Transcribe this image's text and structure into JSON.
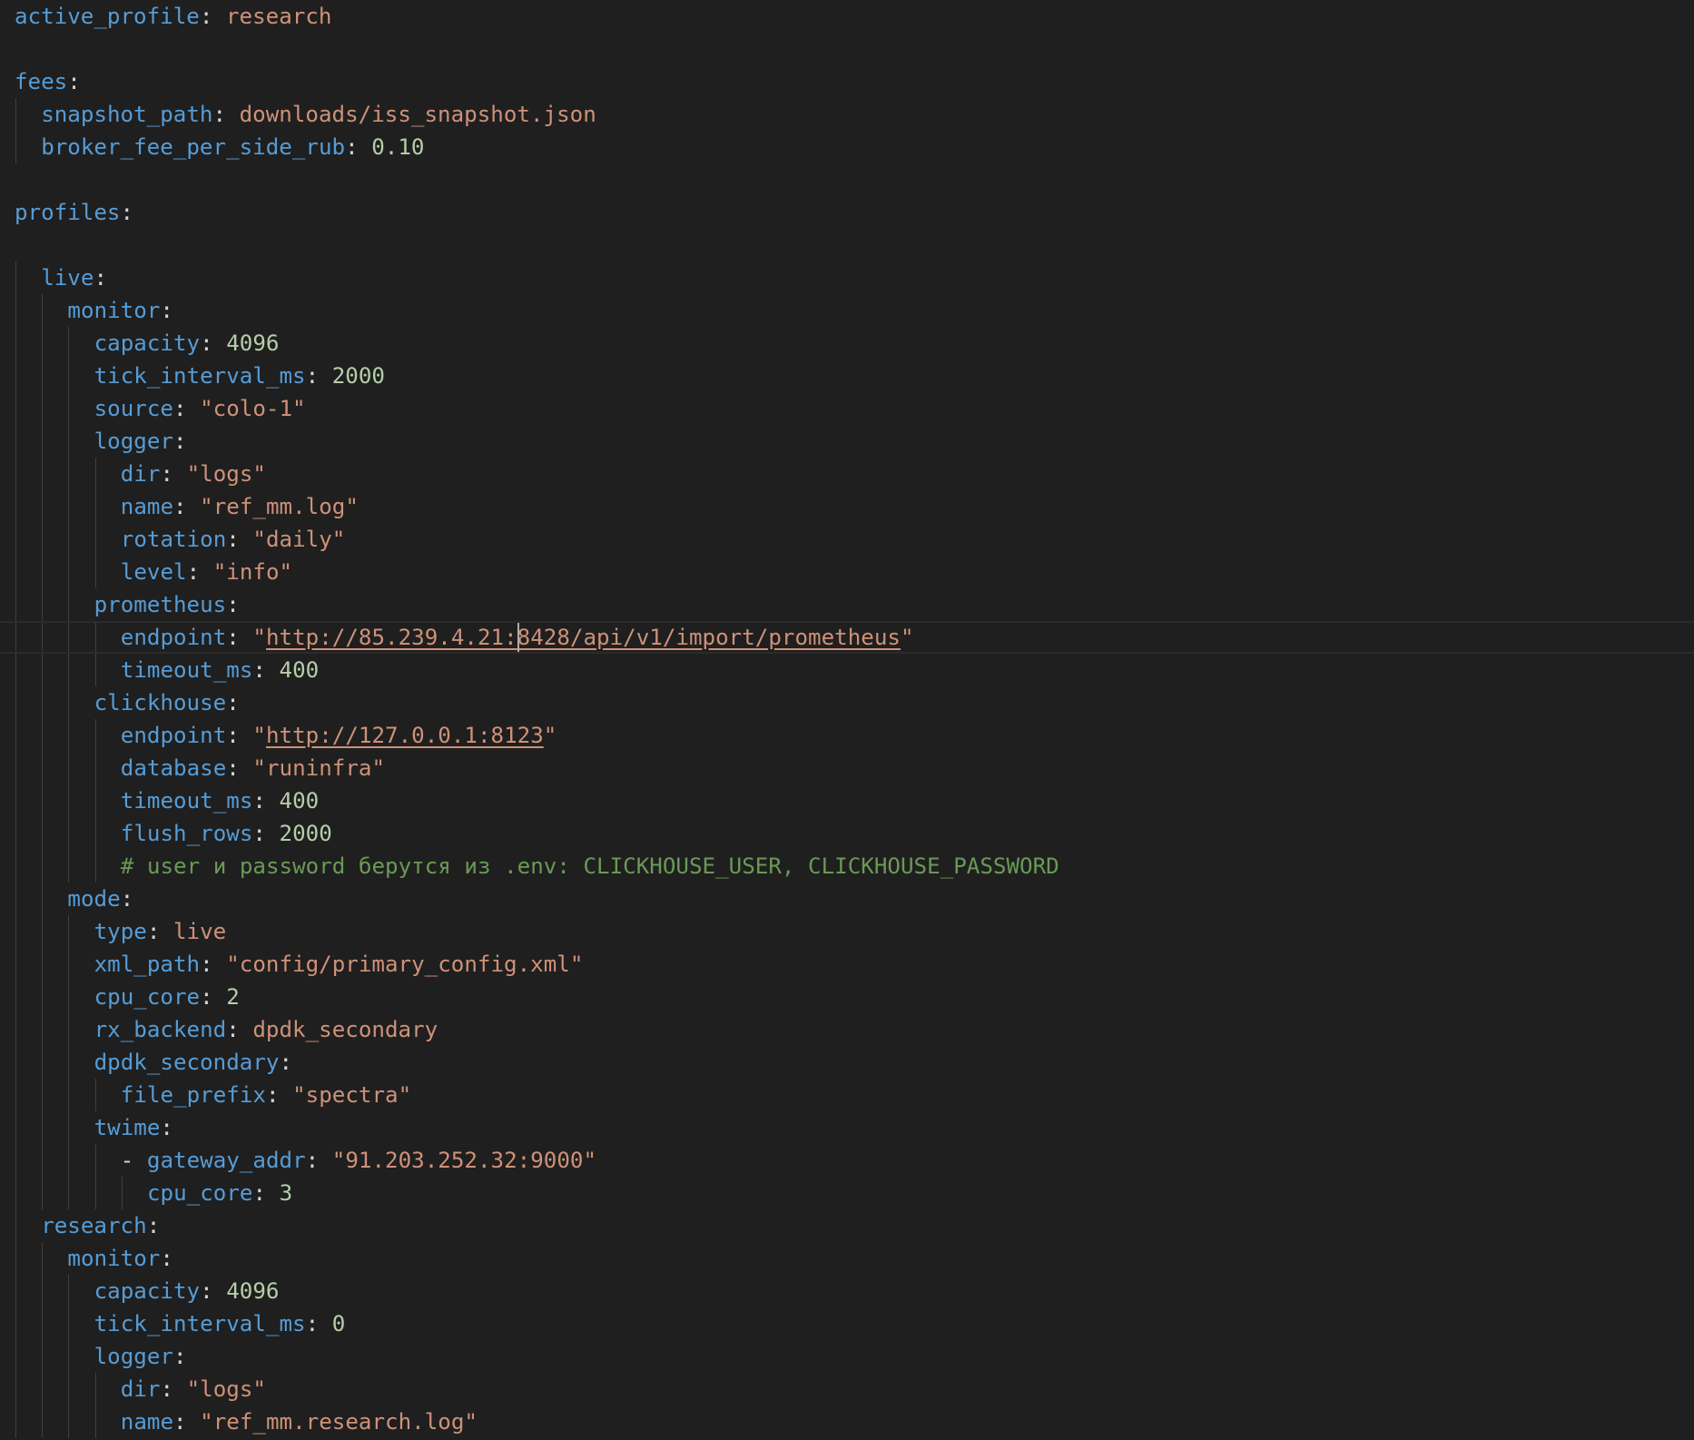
{
  "editor": {
    "language": "yaml",
    "colors": {
      "background": "#1f1f1f",
      "key": "#569cd6",
      "string": "#ce9178",
      "number": "#b5cea8",
      "comment": "#6a9955",
      "punctuation": "#d4d4d4"
    },
    "lines": [
      [
        {
          "t": "k",
          "v": "active_profile"
        },
        {
          "t": "p",
          "v": ": "
        },
        {
          "t": "s",
          "v": "research"
        }
      ],
      [],
      [
        {
          "t": "k",
          "v": "fees"
        },
        {
          "t": "p",
          "v": ":"
        }
      ],
      [
        {
          "t": "k",
          "v": "snapshot_path"
        },
        {
          "t": "p",
          "v": ": "
        },
        {
          "t": "s",
          "v": "downloads/iss_snapshot.json"
        }
      ],
      [
        {
          "t": "k",
          "v": "broker_fee_per_side_rub"
        },
        {
          "t": "p",
          "v": ": "
        },
        {
          "t": "n",
          "v": "0.10"
        }
      ],
      [],
      [
        {
          "t": "k",
          "v": "profiles"
        },
        {
          "t": "p",
          "v": ":"
        }
      ],
      [],
      [
        {
          "t": "k",
          "v": "live"
        },
        {
          "t": "p",
          "v": ":"
        }
      ],
      [
        {
          "t": "k",
          "v": "monitor"
        },
        {
          "t": "p",
          "v": ":"
        }
      ],
      [
        {
          "t": "k",
          "v": "capacity"
        },
        {
          "t": "p",
          "v": ": "
        },
        {
          "t": "n",
          "v": "4096"
        }
      ],
      [
        {
          "t": "k",
          "v": "tick_interval_ms"
        },
        {
          "t": "p",
          "v": ": "
        },
        {
          "t": "n",
          "v": "2000"
        }
      ],
      [
        {
          "t": "k",
          "v": "source"
        },
        {
          "t": "p",
          "v": ": "
        },
        {
          "t": "s",
          "v": "\"colo-1\""
        }
      ],
      [
        {
          "t": "k",
          "v": "logger"
        },
        {
          "t": "p",
          "v": ":"
        }
      ],
      [
        {
          "t": "k",
          "v": "dir"
        },
        {
          "t": "p",
          "v": ": "
        },
        {
          "t": "s",
          "v": "\"logs\""
        }
      ],
      [
        {
          "t": "k",
          "v": "name"
        },
        {
          "t": "p",
          "v": ": "
        },
        {
          "t": "s",
          "v": "\"ref_mm.log\""
        }
      ],
      [
        {
          "t": "k",
          "v": "rotation"
        },
        {
          "t": "p",
          "v": ": "
        },
        {
          "t": "s",
          "v": "\"daily\""
        }
      ],
      [
        {
          "t": "k",
          "v": "level"
        },
        {
          "t": "p",
          "v": ": "
        },
        {
          "t": "s",
          "v": "\"info\""
        }
      ],
      [
        {
          "t": "k",
          "v": "prometheus"
        },
        {
          "t": "p",
          "v": ":"
        }
      ],
      [
        {
          "t": "k",
          "v": "endpoint"
        },
        {
          "t": "p",
          "v": ": "
        },
        {
          "t": "s",
          "v": "\""
        },
        {
          "t": "su",
          "v": "http://85.239.4.21:8428/api/v1/import/prometheus"
        },
        {
          "t": "s",
          "v": "\""
        }
      ],
      [
        {
          "t": "k",
          "v": "timeout_ms"
        },
        {
          "t": "p",
          "v": ": "
        },
        {
          "t": "n",
          "v": "400"
        }
      ],
      [
        {
          "t": "k",
          "v": "clickhouse"
        },
        {
          "t": "p",
          "v": ":"
        }
      ],
      [
        {
          "t": "k",
          "v": "endpoint"
        },
        {
          "t": "p",
          "v": ": "
        },
        {
          "t": "s",
          "v": "\""
        },
        {
          "t": "su",
          "v": "http://127.0.0.1:8123"
        },
        {
          "t": "s",
          "v": "\""
        }
      ],
      [
        {
          "t": "k",
          "v": "database"
        },
        {
          "t": "p",
          "v": ": "
        },
        {
          "t": "s",
          "v": "\"runinfra\""
        }
      ],
      [
        {
          "t": "k",
          "v": "timeout_ms"
        },
        {
          "t": "p",
          "v": ": "
        },
        {
          "t": "n",
          "v": "400"
        }
      ],
      [
        {
          "t": "k",
          "v": "flush_rows"
        },
        {
          "t": "p",
          "v": ": "
        },
        {
          "t": "n",
          "v": "2000"
        }
      ],
      [
        {
          "t": "c",
          "v": "# user и password берутся из .env: CLICKHOUSE_USER, CLICKHOUSE_PASSWORD"
        }
      ],
      [
        {
          "t": "k",
          "v": "mode"
        },
        {
          "t": "p",
          "v": ":"
        }
      ],
      [
        {
          "t": "k",
          "v": "type"
        },
        {
          "t": "p",
          "v": ": "
        },
        {
          "t": "s",
          "v": "live"
        }
      ],
      [
        {
          "t": "k",
          "v": "xml_path"
        },
        {
          "t": "p",
          "v": ": "
        },
        {
          "t": "s",
          "v": "\"config/primary_config.xml\""
        }
      ],
      [
        {
          "t": "k",
          "v": "cpu_core"
        },
        {
          "t": "p",
          "v": ": "
        },
        {
          "t": "n",
          "v": "2"
        }
      ],
      [
        {
          "t": "k",
          "v": "rx_backend"
        },
        {
          "t": "p",
          "v": ": "
        },
        {
          "t": "s",
          "v": "dpdk_secondary"
        }
      ],
      [
        {
          "t": "k",
          "v": "dpdk_secondary"
        },
        {
          "t": "p",
          "v": ":"
        }
      ],
      [
        {
          "t": "k",
          "v": "file_prefix"
        },
        {
          "t": "p",
          "v": ": "
        },
        {
          "t": "s",
          "v": "\"spectra\""
        }
      ],
      [
        {
          "t": "k",
          "v": "twime"
        },
        {
          "t": "p",
          "v": ":"
        }
      ],
      [
        {
          "t": "p",
          "v": "- "
        },
        {
          "t": "k",
          "v": "gateway_addr"
        },
        {
          "t": "p",
          "v": ": "
        },
        {
          "t": "s",
          "v": "\"91.203.252.32:9000\""
        }
      ],
      [
        {
          "t": "k",
          "v": "cpu_core"
        },
        {
          "t": "p",
          "v": ": "
        },
        {
          "t": "n",
          "v": "3"
        }
      ],
      [
        {
          "t": "k",
          "v": "research"
        },
        {
          "t": "p",
          "v": ":"
        }
      ],
      [
        {
          "t": "k",
          "v": "monitor"
        },
        {
          "t": "p",
          "v": ":"
        }
      ],
      [
        {
          "t": "k",
          "v": "capacity"
        },
        {
          "t": "p",
          "v": ": "
        },
        {
          "t": "n",
          "v": "4096"
        }
      ],
      [
        {
          "t": "k",
          "v": "tick_interval_ms"
        },
        {
          "t": "p",
          "v": ": "
        },
        {
          "t": "n",
          "v": "0"
        }
      ],
      [
        {
          "t": "k",
          "v": "logger"
        },
        {
          "t": "p",
          "v": ":"
        }
      ],
      [
        {
          "t": "k",
          "v": "dir"
        },
        {
          "t": "p",
          "v": ": "
        },
        {
          "t": "s",
          "v": "\"logs\""
        }
      ],
      [
        {
          "t": "k",
          "v": "name"
        },
        {
          "t": "p",
          "v": ": "
        },
        {
          "t": "s",
          "v": "\"ref_mm.research.log\""
        }
      ]
    ]
  }
}
